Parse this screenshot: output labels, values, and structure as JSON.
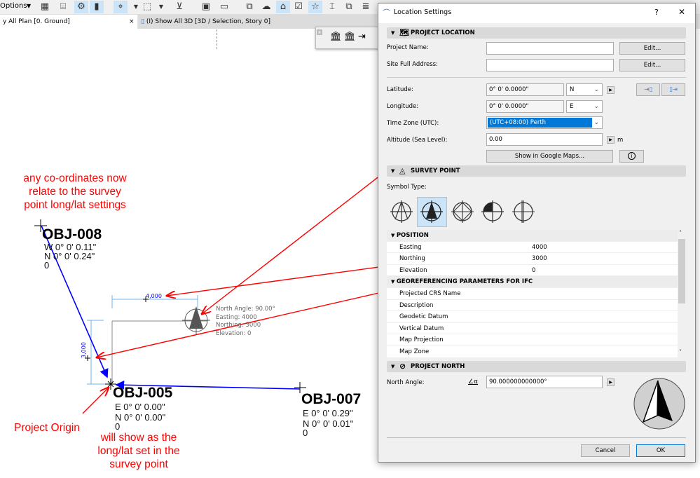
{
  "toolbar": {
    "options_label": "Options"
  },
  "tabs": [
    {
      "label": "y All Plan [0. Ground]",
      "close": "×"
    },
    {
      "label": "(I) Show All 3D [3D / Selection, Story 0]"
    }
  ],
  "dialog": {
    "title": "Location Settings",
    "help": "?",
    "close": "✕",
    "project_location": {
      "header": "PROJECT LOCATION",
      "project_name_label": "Project Name:",
      "project_name_value": "",
      "site_address_label": "Site Full Address:",
      "site_address_value": "",
      "edit_label": "Edit...",
      "latitude_label": "Latitude:",
      "latitude_value": "0° 0' 0.0000\"",
      "latitude_dir": "N",
      "longitude_label": "Longitude:",
      "longitude_value": "0° 0' 0.0000\"",
      "longitude_dir": "E",
      "timezone_label": "Time Zone (UTC):",
      "timezone_value": "(UTC+08:00) Perth",
      "altitude_label": "Altitude (Sea Level):",
      "altitude_value": "0.00",
      "altitude_unit": "m",
      "google_maps_label": "Show in Google Maps...",
      "info": "i"
    },
    "survey_point": {
      "header": "SURVEY POINT",
      "symbol_type_label": "Symbol Type:",
      "selected_symbol": 2,
      "position_header": "POSITION",
      "position": [
        {
          "k": "Easting",
          "v": "4000"
        },
        {
          "k": "Northing",
          "v": "3000"
        },
        {
          "k": "Elevation",
          "v": "0"
        }
      ],
      "georef_header": "GEOREFERENCING PARAMETERS FOR IFC",
      "georef": [
        "Projected CRS Name",
        "Description",
        "Geodetic Datum",
        "Vertical Datum",
        "Map Projection",
        "Map Zone"
      ]
    },
    "project_north": {
      "header": "PROJECT NORTH",
      "north_angle_label": "North Angle:",
      "north_angle_value": "90.000000000000°"
    },
    "cancel": "Cancel",
    "ok": "OK"
  },
  "drawing": {
    "obj008": {
      "name": "OBJ-008",
      "l1": "W 0° 0' 0.11\"",
      "l2": "N 0° 0' 0.24\"",
      "l3": "0"
    },
    "obj005": {
      "name": "OBJ-005",
      "l1": "E 0° 0' 0.00\"",
      "l2": "N 0° 0' 0.00\"",
      "l3": "0"
    },
    "obj007": {
      "name": "OBJ-007",
      "l1": "E 0° 0' 0.29\"",
      "l2": "N 0° 0' 0.01\"",
      "l3": "0"
    },
    "survey_info": [
      "North Angle: 90.00°",
      "Easting: 4000",
      "Northing: 3000",
      "Elevation: 0"
    ],
    "dim_x": "4,000",
    "dim_y": "3,000"
  },
  "annotations": {
    "note1": [
      "any co-ordinates now",
      "relate to the survey",
      "point long/lat settings"
    ],
    "origin": "Project Origin",
    "note2": [
      "will show as the",
      "long/lat set in the",
      "survey point"
    ]
  },
  "colors": {
    "annotation": "#ff0000",
    "highlight": "#ffff40",
    "link": "#0000ff",
    "dimension": "#3d8fe0",
    "selection": "#0078d7"
  }
}
